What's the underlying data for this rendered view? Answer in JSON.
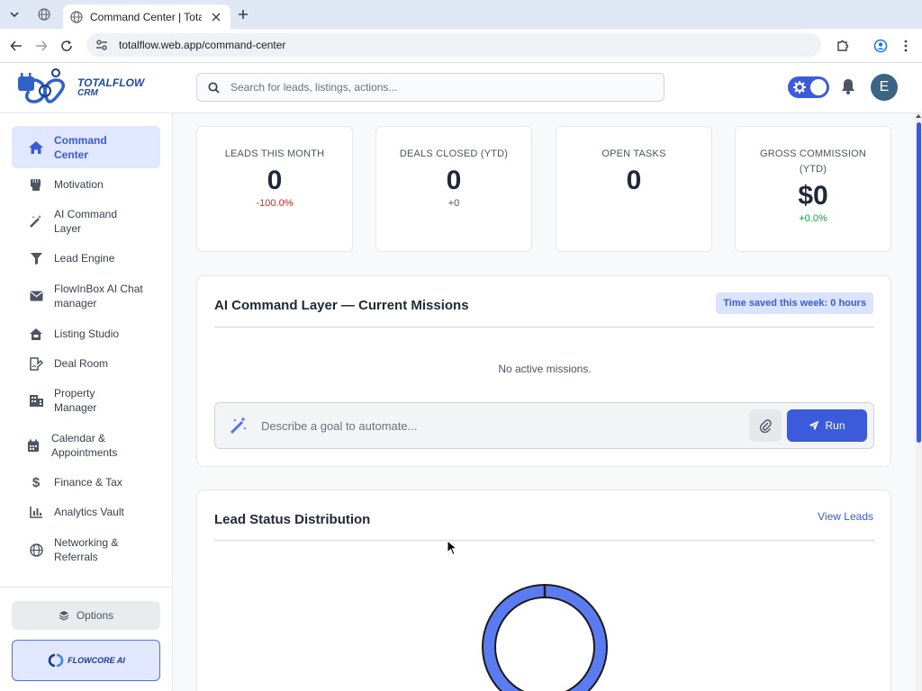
{
  "browser": {
    "tab_title": "Command Center | TotalFlow",
    "url": "totalflow.web.app/command-center"
  },
  "header": {
    "logo_line1": "TOTALFLOW",
    "logo_line2": "CRM",
    "search_placeholder": "Search for leads, listings, actions...",
    "avatar_initial": "E",
    "accent": "#3b5bdb"
  },
  "sidebar": {
    "items": [
      {
        "label": "Command Center",
        "icon": "home-icon",
        "active": true
      },
      {
        "label": "Motivation",
        "icon": "fist-icon"
      },
      {
        "label": "AI Command Layer",
        "icon": "magic-wand-icon"
      },
      {
        "label": "Lead Engine",
        "icon": "funnel-icon"
      },
      {
        "label": "FlowInBox AI Chat manager",
        "icon": "envelope-icon"
      },
      {
        "label": "Listing Studio",
        "icon": "house-sign-icon"
      },
      {
        "label": "Deal Room",
        "icon": "file-signature-icon"
      },
      {
        "label": "Property Manager",
        "icon": "building-icon"
      },
      {
        "label": "Calendar & Appointments",
        "icon": "calendar-icon"
      },
      {
        "label": "Finance & Tax",
        "icon": "dollar-icon"
      },
      {
        "label": "Analytics Vault",
        "icon": "bar-chart-icon"
      },
      {
        "label": "Networking & Referrals",
        "icon": "globe-icon"
      }
    ],
    "options_label": "Options",
    "flowcore_label": "FLOWCORE AI"
  },
  "stats": [
    {
      "label": "LEADS THIS MONTH",
      "value": "0",
      "delta": "-100.0%",
      "tone": "neg"
    },
    {
      "label": "DEALS CLOSED (YTD)",
      "value": "0",
      "delta": "+0",
      "tone": "neu"
    },
    {
      "label": "OPEN TASKS",
      "value": "0",
      "delta": "",
      "tone": "neu"
    },
    {
      "label": "GROSS COMMISSION (YTD)",
      "value": "$0",
      "delta": "+0.0%",
      "tone": "pos"
    }
  ],
  "missions": {
    "title": "AI Command Layer — Current Missions",
    "badge": "Time saved this week: 0 hours",
    "empty_text": "No active missions.",
    "goal_placeholder": "Describe a goal to automate...",
    "run_label": "Run"
  },
  "lead_status": {
    "title": "Lead Status Distribution",
    "link_label": "View Leads",
    "donut_color": "#5b7cf0"
  }
}
